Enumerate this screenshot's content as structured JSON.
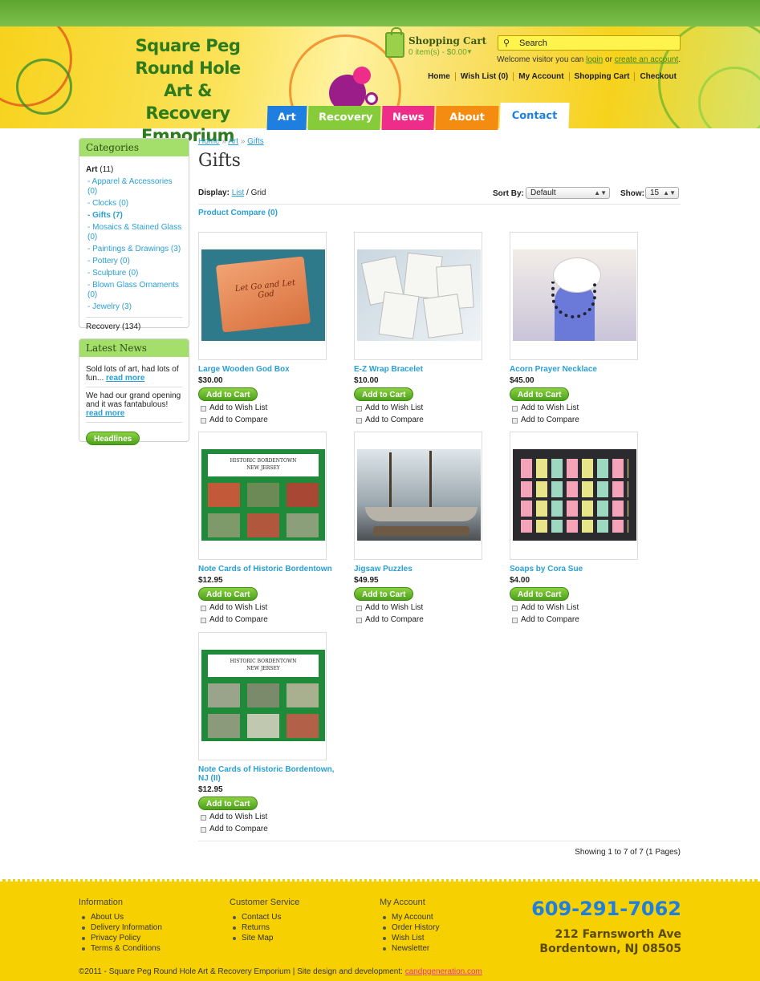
{
  "logo": {
    "line1": "Square Peg",
    "line2": "Round Hole",
    "line3": "Art & Recovery",
    "line4": "Emporium"
  },
  "cart": {
    "title": "Shopping Cart",
    "info": "0 item(s) - $0.00"
  },
  "search": {
    "placeholder": "Search"
  },
  "welcome": {
    "prefix": "Welcome visitor you can",
    "login": "login",
    "or": "or",
    "create": "create an account",
    "dot": "."
  },
  "topnav": [
    "Home",
    "Wish List (0)",
    "My Account",
    "Shopping Cart",
    "Checkout"
  ],
  "tabs": [
    "Art",
    "Recovery",
    "News",
    "About us",
    "Contact"
  ],
  "categories": {
    "title": "Categories",
    "top": {
      "name": "Art",
      "count": "(11)"
    },
    "items": [
      "- Apparel & Accessories (0)",
      "- Clocks (0)",
      "- Gifts (7)",
      "- Mosaics & Stained Glass (0)",
      "- Paintings & Drawings (3)",
      "- Pottery (0)",
      "- Sculpture (0)",
      "- Blown Glass Ornaments (0)",
      "- Jewelry (3)"
    ],
    "recovery": "Recovery (134)"
  },
  "latest_news": {
    "title": "Latest News",
    "items": [
      {
        "text": "Sold lots of art, had lots of fun...",
        "link": "read more"
      },
      {
        "text": "We had our grand opening and it was fantabulous!",
        "link": "read more"
      }
    ],
    "button": "Headlines"
  },
  "breadcrumb": {
    "home": "Home",
    "sep": "»",
    "art": "Art",
    "gifts": "Gifts"
  },
  "page_title": "Gifts",
  "display": {
    "label": "Display:",
    "list": "List",
    "grid": "/ Grid"
  },
  "sort": {
    "label": "Sort By:",
    "value": "Default"
  },
  "show": {
    "label": "Show:",
    "value": "15"
  },
  "compare": "Product Compare (0)",
  "product_labels": {
    "add": "Add to Cart",
    "wish": "Add to Wish List",
    "compare": "Add to Compare"
  },
  "products": [
    {
      "name": "Large Wooden God Box",
      "price": "$30.00",
      "img_text": "Let Go and Let God"
    },
    {
      "name": "E-Z Wrap Bracelet",
      "price": "$10.00"
    },
    {
      "name": "Acorn Prayer Necklace",
      "price": "$45.00"
    },
    {
      "name": "Note Cards of Historic Bordentown",
      "price": "$12.95",
      "img_text": "HISTORIC  BORDENTOWN",
      "img_sub": "NEW JERSEY"
    },
    {
      "name": "Jigsaw Puzzles",
      "price": "$49.95"
    },
    {
      "name": "Soaps by Cora Sue",
      "price": "$4.00"
    },
    {
      "name": "Note Cards of Historic Bordentown, NJ (II)",
      "price": "$12.95",
      "img_text": "HISTORIC  BORDENTOWN",
      "img_sub": "NEW JERSEY"
    }
  ],
  "showing": "Showing 1 to 7 of 7 (1 Pages)",
  "footer": {
    "information": {
      "title": "Information",
      "items": [
        "About Us",
        "Delivery Information",
        "Privacy Policy",
        "Terms & Conditions"
      ]
    },
    "customer": {
      "title": "Customer Service",
      "items": [
        "Contact Us",
        "Returns",
        "Site Map"
      ]
    },
    "account": {
      "title": "My Account",
      "items": [
        "My Account",
        "Order History",
        "Wish List",
        "Newsletter"
      ]
    },
    "phone": "609-291-7062",
    "address1": "212 Farnsworth Ave",
    "address2": "Bordentown, NJ 08505",
    "copyright": "©2011 - Square Peg Round Hole Art & Recovery Emporium   |   Site design and development:",
    "dev_link": "candpgeneration.com"
  },
  "colors": {
    "green": "#86cc3a",
    "blue_link": "#2a9fd6",
    "yellow": "#f6d000",
    "pink": "#ee2d8a",
    "orange": "#f58c12"
  }
}
